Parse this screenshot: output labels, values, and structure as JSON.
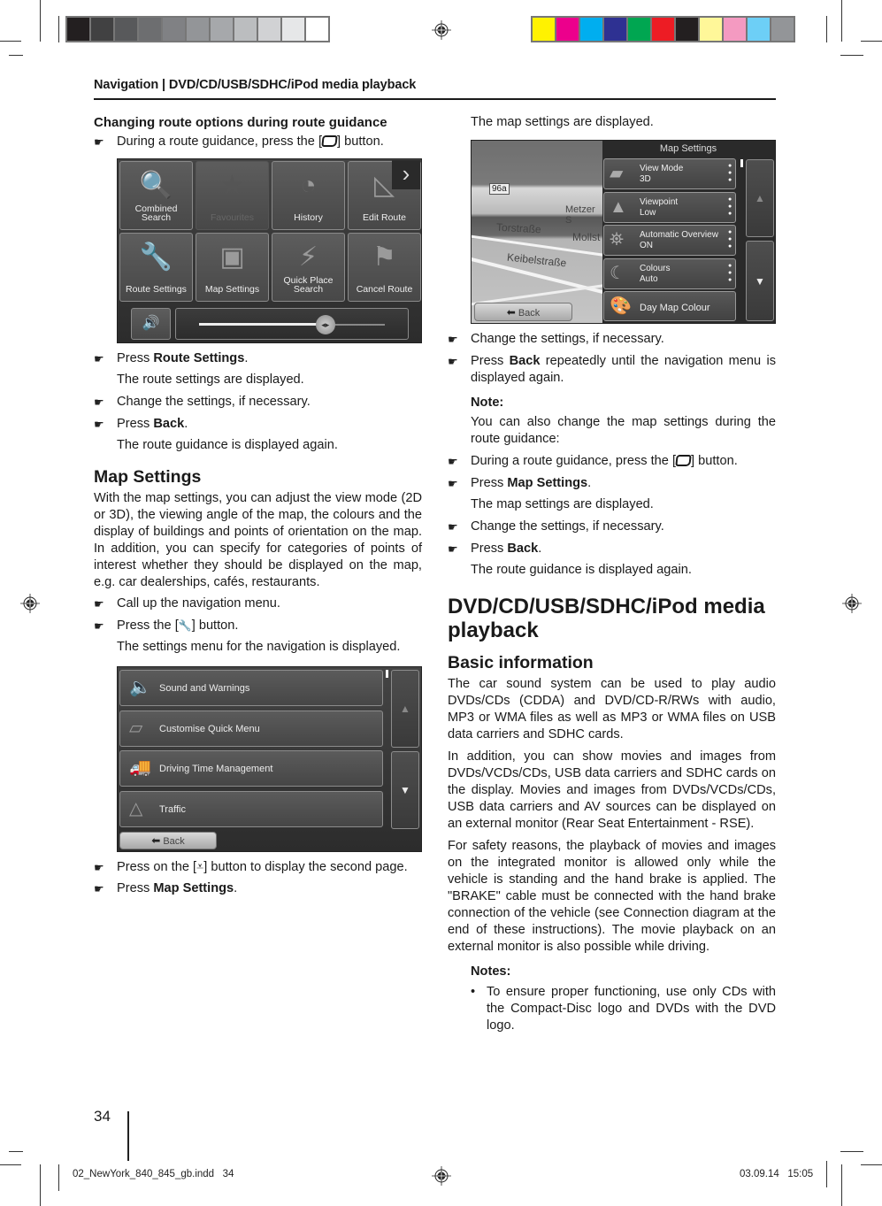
{
  "print_marks": {
    "gray_swatches": [
      "#231f20",
      "#414142",
      "#58595b",
      "#6d6e70",
      "#808184",
      "#939598",
      "#a6a8ab",
      "#bbbdbf",
      "#d1d2d4",
      "#e6e7e8",
      "#ffffff"
    ],
    "color_swatches": [
      "#fff200",
      "#ec008c",
      "#00aeef",
      "#2e3192",
      "#00a651",
      "#ed1c24",
      "#231f20",
      "#fff799",
      "#f49ac1",
      "#6dcff6",
      "#939598"
    ]
  },
  "header": {
    "running_head": "Navigation | DVD/CD/USB/SDHC/iPod media playback"
  },
  "left_column": {
    "heading_route_options": "Changing route options during route guidance",
    "step1_pre": "During a route guidance, press the [",
    "step1_post": "] button.",
    "nav_menu_screen": {
      "tiles": [
        {
          "label": "Combined\nSearch",
          "icon": "combined-search-icon",
          "glyph": "🔍",
          "enabled": true
        },
        {
          "label": "Favourites",
          "icon": "star-icon",
          "glyph": "★",
          "enabled": false
        },
        {
          "label": "History",
          "icon": "history-icon",
          "glyph": "◔",
          "enabled": true
        },
        {
          "label": "Edit Route",
          "icon": "edit-route-icon",
          "glyph": "◺",
          "enabled": true
        },
        {
          "label": "Route Settings",
          "icon": "route-settings-icon",
          "glyph": "🔧",
          "enabled": true
        },
        {
          "label": "Map Settings",
          "icon": "map-settings-icon",
          "glyph": "▣",
          "enabled": true
        },
        {
          "label": "Quick Place\nSearch",
          "icon": "quick-place-icon",
          "glyph": "⚡",
          "enabled": true
        },
        {
          "label": "Cancel Route",
          "icon": "cancel-route-flag-icon",
          "glyph": "⚑",
          "enabled": true
        }
      ],
      "next_glyph": "›",
      "volume_level": 0.68,
      "volume_glyph": "🔊"
    },
    "step2_pre": "Press ",
    "step2_bold": "Route Settings",
    "step2_post": ".",
    "result2": "The route settings are displayed.",
    "step3": "Change the settings, if necessary.",
    "step4_pre": "Press ",
    "step4_bold": "Back",
    "step4_post": ".",
    "result4": "The route guidance is displayed again.",
    "heading_map_settings": "Map Settings",
    "map_settings_intro": "With the map settings, you can adjust the view mode (2D or 3D), the viewing angle of the map, the colours and the display of buildings and points of orientation on the map. In addition, you can specify for categories of points of interest whether they should be displayed on the map, e.g. car dealerships, cafés, restaurants.",
    "step5": "Call up the navigation menu.",
    "step6_pre": "Press the [",
    "step6_glyph": "🔧",
    "step6_post": "] button.",
    "result6": "The settings menu for the navigation is displayed.",
    "settings_screen": {
      "rows": [
        {
          "label": "Sound and Warnings",
          "icon": "speaker-icon",
          "glyph": "🔈"
        },
        {
          "label": "Customise Quick Menu",
          "icon": "quick-menu-icon",
          "glyph": "▱"
        },
        {
          "label": "Driving Time Management",
          "icon": "truck-icon",
          "glyph": "🚚"
        },
        {
          "label": "Traffic",
          "icon": "warning-triangle-icon",
          "glyph": "△"
        }
      ],
      "back_label": "Back",
      "up_glyph": "▲",
      "down_glyph": "▼"
    },
    "step7_pre": "Press on the [",
    "step7_glyph": "⩡",
    "step7_post": "] button to display the second page.",
    "step8_pre": "Press ",
    "step8_bold": "Map Settings",
    "step8_post": "."
  },
  "right_column": {
    "result_top": "The map settings are displayed.",
    "map_settings_screen": {
      "title": "Map Settings",
      "map_labels": {
        "route": "96a",
        "street1": "Metzer S",
        "street2": "Torstraße",
        "street3": "Mollst",
        "street4": "Keibelstraße"
      },
      "rows": [
        {
          "name": "View Mode",
          "value": "3D",
          "icon": "view-mode-icon",
          "glyph": "▰"
        },
        {
          "name": "Viewpoint",
          "value": "Low",
          "icon": "viewpoint-icon",
          "glyph": "▲"
        },
        {
          "name": "Automatic Overview",
          "value": "ON",
          "icon": "binoculars-icon",
          "glyph": "⛯"
        },
        {
          "name": "Colours",
          "value": "Auto",
          "icon": "day-night-icon",
          "glyph": "☾"
        }
      ],
      "last_row": {
        "label": "Day Map Colour",
        "icon": "palette-icon",
        "glyph": "🎨"
      },
      "back_label": "Back"
    },
    "step1": "Change the settings, if necessary.",
    "step2_pre": "Press ",
    "step2_bold": "Back",
    "step2_post": " repeatedly until the navigation menu is displayed again.",
    "note_label": "Note:",
    "note_text": "You can also change the map settings during the route guidance:",
    "step3_pre": "During a route guidance, press the [",
    "step3_post": "] button.",
    "step4_pre": "Press ",
    "step4_bold": "Map Settings",
    "step4_post": ".",
    "result4": "The map settings are displayed.",
    "step5": "Change the settings, if necessary.",
    "step6_pre": "Press ",
    "step6_bold": "Back",
    "step6_post": ".",
    "result6": "The route guidance is displayed again.",
    "chapter_heading": "DVD/CD/USB/SDHC/iPod media playback",
    "heading_basic": "Basic information",
    "para1": "The car sound system can be used to play audio DVDs/CDs (CDDA) and DVD/CD-R/RWs with audio, MP3 or WMA files as well as MP3 or WMA files on USB data carriers and SDHC cards.",
    "para2": "In addition, you can show movies and images from DVDs/VCDs/CDs, USB data carriers and SDHC cards on the display. Movies and images from DVDs/VCDs/CDs, USB data carriers and AV sources can be displayed on an external monitor (Rear Seat Entertainment - RSE).",
    "para3": "For safety reasons, the playback of movies and images on the integrated monitor is allowed only while the vehicle is standing and the hand brake is applied. The \"BRAKE\" cable must be connected with the hand brake connection of the vehicle (see Connection diagram at the end of these instructions). The movie playback on an external monitor is also possible while driving.",
    "notes_label": "Notes:",
    "notes": [
      "To ensure proper functioning, use only CDs with the Compact-Disc logo and DVDs with the DVD logo."
    ]
  },
  "footer": {
    "page_number": "34",
    "slug_file": "02_NewYork_840_845_gb.indd   34",
    "slug_date": "03.09.14   15:05"
  },
  "glyphs": {
    "hand": "☛",
    "bullet": "•"
  }
}
